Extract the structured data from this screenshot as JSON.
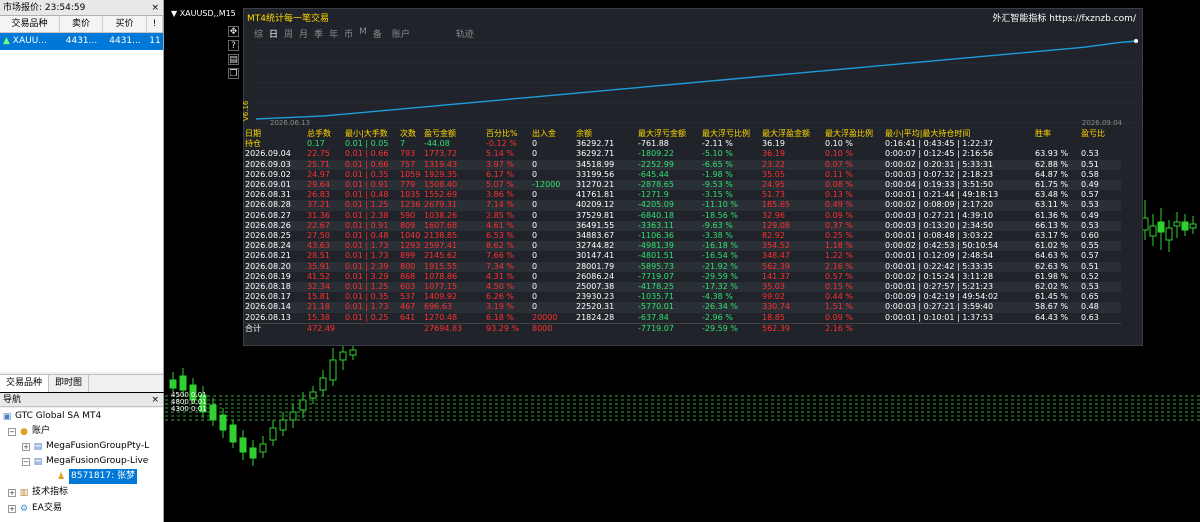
{
  "market_watch": {
    "title": "市场报价: 23:54:59",
    "columns": [
      "交易品种",
      "卖价",
      "买价",
      "!"
    ],
    "rows": [
      {
        "symbol": "XAUU...",
        "bid": "4431...",
        "ask": "4431...",
        "extra": "11"
      }
    ],
    "tabs": [
      "交易品种",
      "即时图"
    ]
  },
  "navigator": {
    "title": "导航",
    "items": [
      {
        "label": "GTC Global SA MT4",
        "icon": "broker-icon"
      },
      {
        "label": "账户",
        "icon": "accounts-icon"
      },
      {
        "label": "MegaFusionGroupPty-L",
        "icon": "server-icon"
      },
      {
        "label": "MegaFusionGroup-Live",
        "icon": "server-icon"
      },
      {
        "label": "8571817: 张梦",
        "icon": "user-icon"
      },
      {
        "label": "技术指标",
        "icon": "indicators-icon"
      },
      {
        "label": "EA交易",
        "icon": "ea-icon"
      }
    ]
  },
  "chart": {
    "header": "XAUUSD,,M15",
    "version": "V6.16",
    "level_labels": [
      "4500 0.01",
      "4800 0.01",
      "4300 0.01"
    ]
  },
  "overlay": {
    "title": "MT4统计每一笔交易",
    "brand": "外汇智能指标 https://fxznzb.com/",
    "tabs": [
      "综",
      "日",
      "周",
      "月",
      "季",
      "年",
      "币",
      "M",
      "备",
      "账户",
      "轨迹"
    ],
    "active_tab": "日",
    "date_start": "2026.06.13",
    "date_end": "2026.09.04",
    "headers": [
      "日期",
      "总手数",
      "最小|大手数",
      "次数",
      "盈亏金额",
      "百分比%",
      "出入金",
      "余额",
      "最大浮亏金额",
      "最大浮亏比例",
      "最大浮盈金额",
      "最大浮盈比例",
      "最小|平均|最大持仓时间",
      "胜率",
      "盈亏比"
    ],
    "hold_row": [
      "持仓",
      "0.17",
      "0.01 | 0.05",
      "7",
      "-44.08",
      "-0.12 %",
      "0",
      "36292.71",
      "-761.88",
      "-2.11 %",
      "36.19",
      "0.10 %",
      "0:16:41 | 0:43:45 | 1:22:37",
      "",
      ""
    ],
    "rows": [
      [
        "2026.09.04",
        "22.75",
        "0.01 | 0.66",
        "793",
        "1773.72",
        "5.14 %",
        "0",
        "36292.71",
        "-1809.22",
        "-5.10 %",
        "36.19",
        "0.10 %",
        "0:00:07 | 0:12:45 | 2:16:56",
        "63.93 %",
        "0.53"
      ],
      [
        "2026.09.03",
        "25.71",
        "0.01 | 0.66",
        "757",
        "1319.43",
        "3.97 %",
        "0",
        "34518.99",
        "-2252.99",
        "-6.65 %",
        "23.22",
        "0.07 %",
        "0:00:02 | 0:20:31 | 5:33:31",
        "62.88 %",
        "0.51"
      ],
      [
        "2026.09.02",
        "24.97",
        "0.01 | 0.35",
        "1059",
        "1929.35",
        "6.17 %",
        "0",
        "33199.56",
        "-645.44",
        "-1.98 %",
        "35.05",
        "0.11 %",
        "0:00:03 | 0:07:32 | 2:18:23",
        "64.87 %",
        "0.58"
      ],
      [
        "2026.09.01",
        "29.64",
        "0.01 | 0.91",
        "779",
        "1508.40",
        "5.07 %",
        "-12000",
        "31270.21",
        "-2878.65",
        "-9.53 %",
        "24.95",
        "0.08 %",
        "0:00:04 | 0:19:33 | 3:51:50",
        "61.75 %",
        "0.49"
      ],
      [
        "2026.08.31",
        "26.83",
        "0.01 | 0.48",
        "1035",
        "1552.69",
        "3.86 %",
        "0",
        "41761.81",
        "-1271.9",
        "-3.15 %",
        "51.73",
        "0.13 %",
        "0:00:01 | 0:21:44 | 49:18:13",
        "63.48 %",
        "0.57"
      ],
      [
        "2026.08.28",
        "37.21",
        "0.01 | 1.25",
        "1236",
        "2679.31",
        "7.14 %",
        "0",
        "40209.12",
        "-4205.09",
        "-11.10 %",
        "185.65",
        "0.49 %",
        "0:00:02 | 0:08:09 | 2:17:20",
        "63.11 %",
        "0.53"
      ],
      [
        "2026.08.27",
        "31.36",
        "0.01 | 2.38",
        "590",
        "1038.26",
        "2.85 %",
        "0",
        "37529.81",
        "-6840.18",
        "-18.56 %",
        "32.96",
        "0.09 %",
        "0:00:03 | 0:27:21 | 4:39:10",
        "61.36 %",
        "0.49"
      ],
      [
        "2026.08.26",
        "22.67",
        "0.01 | 0.91",
        "809",
        "1607.68",
        "4.61 %",
        "0",
        "36491.55",
        "-3363.11",
        "-9.63 %",
        "129.08",
        "0.37 %",
        "0:00:03 | 0:13:20 | 2:34:50",
        "66.13 %",
        "0.53"
      ],
      [
        "2026.08.25",
        "27.50",
        "0.01 | 0.48",
        "1040",
        "2138.85",
        "6.53 %",
        "0",
        "34883.67",
        "-1106.36",
        "-3.38 %",
        "82.92",
        "0.25 %",
        "0:00:01 | 0:08:48 | 3:03:22",
        "63.17 %",
        "0.60"
      ],
      [
        "2026.08.24",
        "43.63",
        "0.01 | 1.73",
        "1293",
        "2597.41",
        "8.62 %",
        "0",
        "32744.82",
        "-4981.39",
        "-16.18 %",
        "354.52",
        "1.18 %",
        "0:00:02 | 0:42:53 | 50:10:54",
        "61.02 %",
        "0.55"
      ],
      [
        "2026.08.21",
        "28.51",
        "0.01 | 1.73",
        "899",
        "2145.62",
        "7.66 %",
        "0",
        "30147.41",
        "-4801.51",
        "-16.54 %",
        "348.47",
        "1.22 %",
        "0:00:01 | 0:12:09 | 2:48:54",
        "64.63 %",
        "0.57"
      ],
      [
        "2026.08.20",
        "35.91",
        "0.01 | 2.39",
        "800",
        "1915.55",
        "7.34 %",
        "0",
        "28001.79",
        "-5895.73",
        "-21.92 %",
        "562.39",
        "2.16 %",
        "0:00:01 | 0:22:42 | 5:33:35",
        "62.63 %",
        "0.51"
      ],
      [
        "2026.08.19",
        "41.52",
        "0.01 | 3.29",
        "868",
        "1078.86",
        "4.31 %",
        "0",
        "26086.24",
        "-7719.07",
        "-29.59 %",
        "141.37",
        "0.57 %",
        "0:00:02 | 0:15:24 | 3:11:28",
        "61.98 %",
        "0.52"
      ],
      [
        "2026.08.18",
        "32.34",
        "0.01 | 1.25",
        "603",
        "1077.15",
        "4.50 %",
        "0",
        "25007.38",
        "-4178.25",
        "-17.32 %",
        "35.03",
        "0.15 %",
        "0:00:01 | 0:27:57 | 5:21:23",
        "62.02 %",
        "0.53"
      ],
      [
        "2026.08.17",
        "15.81",
        "0.01 | 0.35",
        "537",
        "1409.92",
        "6.26 %",
        "0",
        "23930.23",
        "-1035.71",
        "-4.38 %",
        "99.02",
        "0.44 %",
        "0:00:09 | 0:42:19 | 49:54:02",
        "61.45 %",
        "0.65"
      ],
      [
        "2026.08.14",
        "21.18",
        "0.01 | 1.73",
        "467",
        "696.63",
        "3.19 %",
        "0",
        "22520.31",
        "-5770.01",
        "-26.34 %",
        "330.74",
        "1.51 %",
        "0:00:03 | 0:27:21 | 3:59:40",
        "58.67 %",
        "0.48"
      ],
      [
        "2026.08.13",
        "15.38",
        "0.01 | 0.25",
        "641",
        "1270.48",
        "6.18 %",
        "20000",
        "21824.28",
        "-637.84",
        "-2.96 %",
        "18.85",
        "0.09 %",
        "0:00:01 | 0:10:01 | 1:37:53",
        "64.43 %",
        "0.63"
      ]
    ],
    "total_row": [
      "合计",
      "472.49",
      "",
      "",
      "27694.83",
      "93.29 %",
      "8000",
      "",
      "-7719.07",
      "-29.59 %",
      "562.39",
      "2.16 %",
      "",
      "",
      ""
    ]
  },
  "colors": {
    "profit": "#ff3030",
    "loss": "#30e070",
    "header": "#ffd700",
    "equity": "#1e9bdc"
  },
  "equity_curve": {
    "values": [
      0,
      1,
      2,
      3,
      4,
      6,
      8,
      10,
      12,
      14,
      16,
      18,
      20,
      22,
      24,
      26,
      28,
      30,
      32,
      34,
      36,
      38,
      40,
      42,
      44,
      46,
      48,
      50,
      52,
      54,
      56,
      58,
      60,
      62,
      64,
      66,
      68,
      70,
      72,
      74,
      76,
      78,
      80,
      82,
      84,
      86,
      88,
      90,
      92,
      95,
      98,
      100
    ],
    "ylim": [
      0,
      100
    ]
  }
}
